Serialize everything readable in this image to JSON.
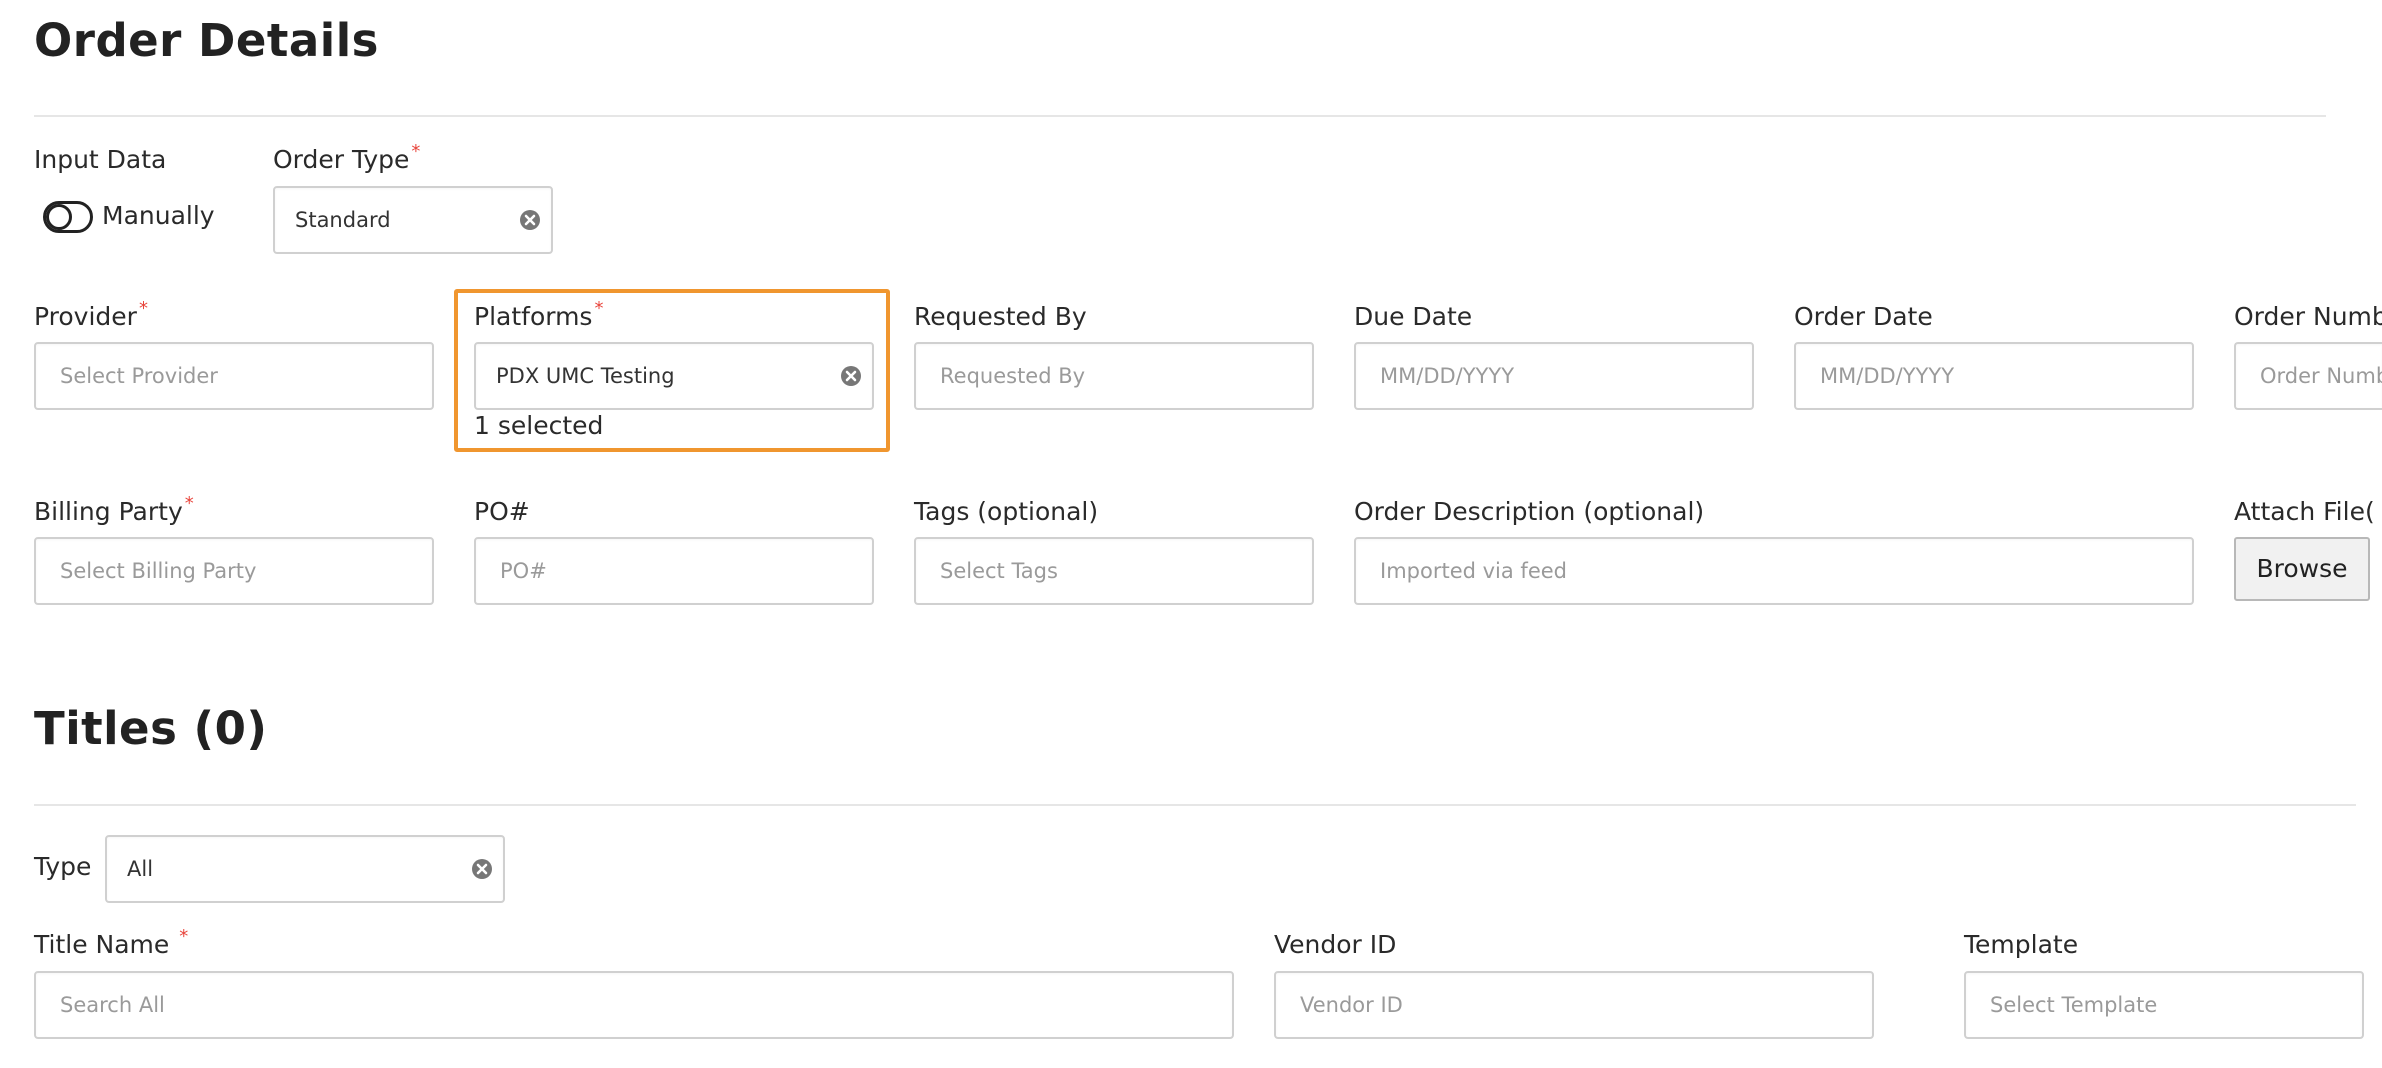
{
  "order_details": {
    "title": "Order Details",
    "input_data": {
      "label": "Input Data",
      "toggle_label": "Manually"
    },
    "order_type": {
      "label": "Order Type",
      "value": "Standard"
    },
    "provider": {
      "label": "Provider",
      "placeholder": "Select Provider"
    },
    "platforms": {
      "label": "Platforms",
      "value": "PDX UMC Testing",
      "selected_text": "1 selected"
    },
    "requested_by": {
      "label": "Requested By",
      "placeholder": "Requested By"
    },
    "due_date": {
      "label": "Due Date",
      "placeholder": "MM/DD/YYYY"
    },
    "order_date": {
      "label": "Order Date",
      "placeholder": "MM/DD/YYYY"
    },
    "order_number": {
      "label": "Order Numb",
      "placeholder": "Order Numb"
    },
    "billing_party": {
      "label": "Billing Party",
      "placeholder": "Select Billing Party"
    },
    "po_number": {
      "label": "PO#",
      "placeholder": "PO#"
    },
    "tags": {
      "label": "Tags (optional)",
      "placeholder": "Select Tags"
    },
    "order_description": {
      "label": "Order Description (optional)",
      "placeholder": "Imported via feed"
    },
    "attach_file": {
      "label": "Attach File(",
      "button_label": "Browse"
    },
    "required_mark": "*"
  },
  "titles": {
    "title": "Titles (0)",
    "type": {
      "label": "Type",
      "value": "All"
    },
    "title_name": {
      "label": "Title Name",
      "placeholder": "Search All"
    },
    "vendor_id": {
      "label": "Vendor ID",
      "placeholder": "Vendor ID"
    },
    "template": {
      "label": "Template",
      "placeholder": "Select Template"
    }
  },
  "colors": {
    "highlight": "#f0962f",
    "required": "#e8453c",
    "border": "#d0d0d0",
    "placeholder": "#9a9a9a"
  },
  "icons": {
    "clear": "clear-circle-icon"
  }
}
